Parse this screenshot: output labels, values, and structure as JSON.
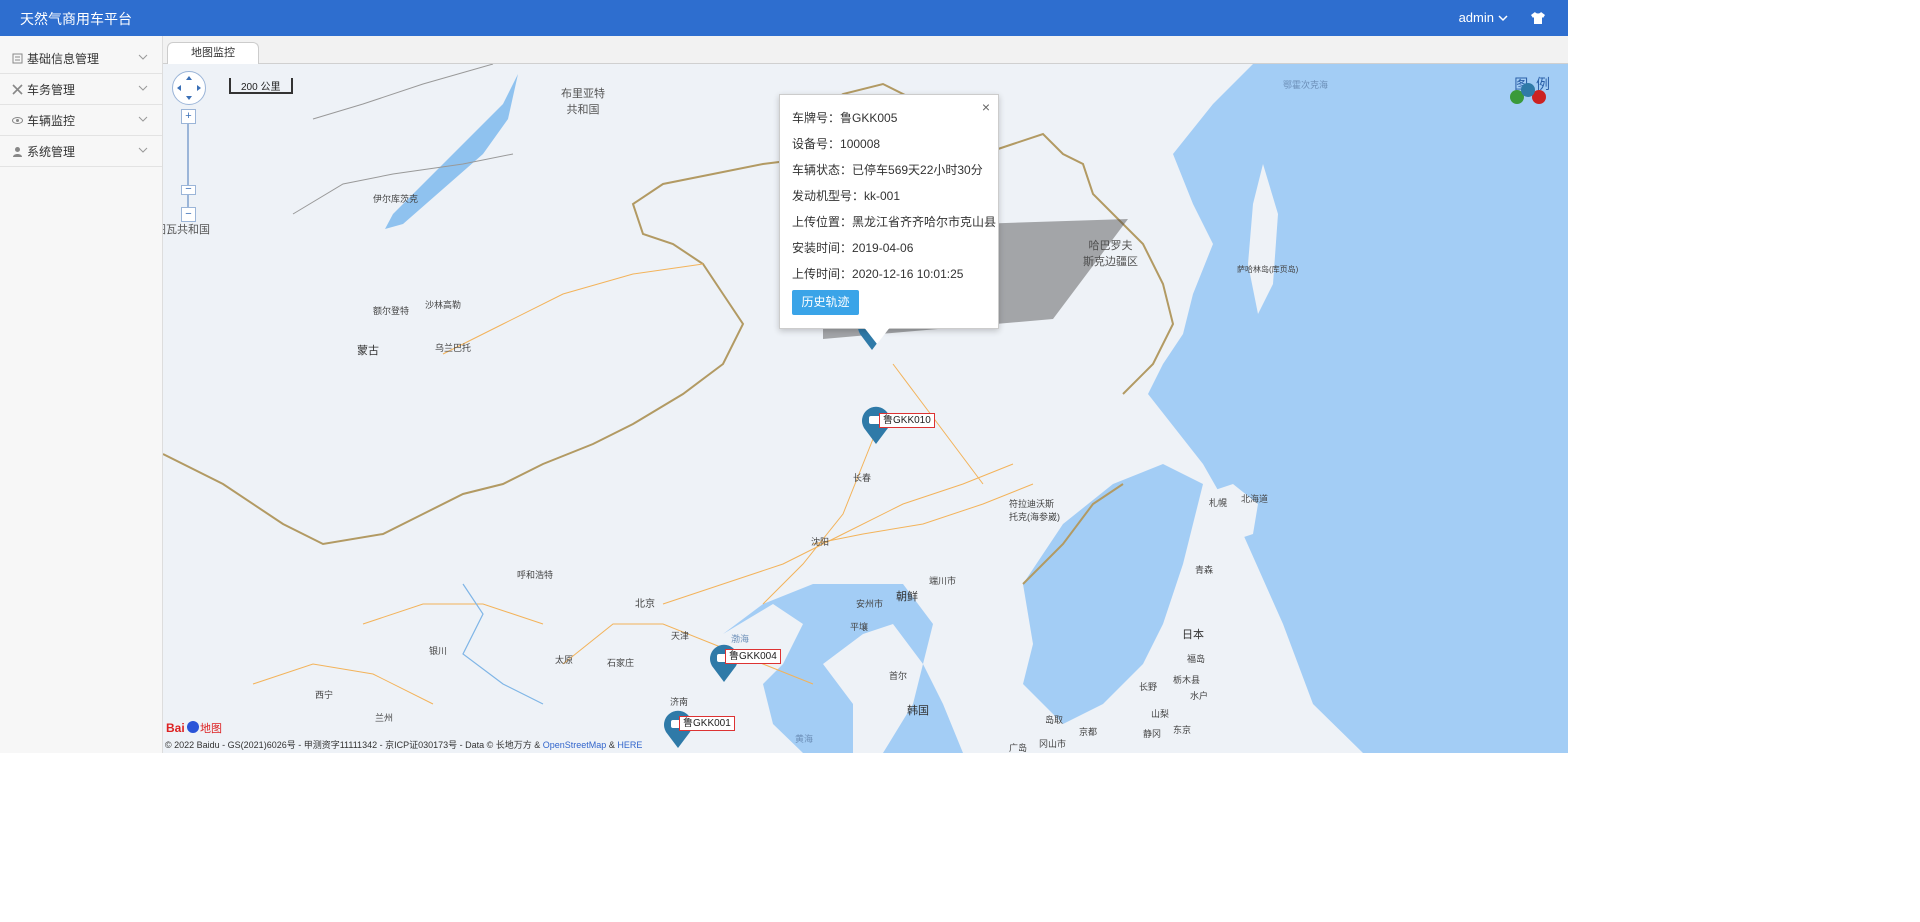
{
  "app": {
    "title": "天然气商用车平台"
  },
  "header": {
    "username": "admin",
    "theme_icon": "shirt-icon"
  },
  "sidebar": {
    "items": [
      {
        "label": "基础信息管理",
        "icon": "list-icon"
      },
      {
        "label": "车务管理",
        "icon": "tools-icon"
      },
      {
        "label": "车辆监控",
        "icon": "eye-icon"
      },
      {
        "label": "系统管理",
        "icon": "user-icon"
      }
    ]
  },
  "tabs": {
    "active": "地图监控"
  },
  "map": {
    "scale_label": "200 公里",
    "legend_label": "图  例",
    "places": [
      {
        "name": "鄂霍次克海",
        "kind": "sea"
      },
      {
        "name": "布里亚特\n共和国",
        "kind": "country"
      },
      {
        "name": "伊尔库茨克",
        "kind": "place"
      },
      {
        "name": "图瓦共和国",
        "kind": "country"
      },
      {
        "name": "额尔登特",
        "kind": "place"
      },
      {
        "name": "沙林高勒",
        "kind": "place"
      },
      {
        "name": "蒙古",
        "kind": "big"
      },
      {
        "name": "乌兰巴托",
        "kind": "place"
      },
      {
        "name": "哈巴罗夫\n斯克边疆区",
        "kind": "country"
      },
      {
        "name": "萨哈林岛(库页岛)",
        "kind": "place"
      },
      {
        "name": "长春",
        "kind": "place"
      },
      {
        "name": "符拉迪沃斯\n托克(海参崴)",
        "kind": "place"
      },
      {
        "name": "札幌",
        "kind": "place"
      },
      {
        "name": "北海道",
        "kind": "place"
      },
      {
        "name": "沈阳",
        "kind": "place"
      },
      {
        "name": "呼和浩特",
        "kind": "place"
      },
      {
        "name": "北京",
        "kind": "place"
      },
      {
        "name": "天津",
        "kind": "place"
      },
      {
        "name": "渤海",
        "kind": "sea"
      },
      {
        "name": "端川市",
        "kind": "place"
      },
      {
        "name": "安州市",
        "kind": "place"
      },
      {
        "name": "朝鲜",
        "kind": "big"
      },
      {
        "name": "平壤",
        "kind": "place"
      },
      {
        "name": "青森",
        "kind": "place"
      },
      {
        "name": "日本",
        "kind": "big"
      },
      {
        "name": "银川",
        "kind": "place"
      },
      {
        "name": "太原",
        "kind": "place"
      },
      {
        "name": "石家庄",
        "kind": "place"
      },
      {
        "name": "济南",
        "kind": "place"
      },
      {
        "name": "首尔",
        "kind": "place"
      },
      {
        "name": "韩国",
        "kind": "big"
      },
      {
        "name": "福岛",
        "kind": "place"
      },
      {
        "name": "栃木县",
        "kind": "place"
      },
      {
        "name": "长野",
        "kind": "place"
      },
      {
        "name": "水户",
        "kind": "place"
      },
      {
        "name": "山梨",
        "kind": "place"
      },
      {
        "name": "东京",
        "kind": "place"
      },
      {
        "name": "静冈",
        "kind": "place"
      },
      {
        "name": "西宁",
        "kind": "place"
      },
      {
        "name": "兰州",
        "kind": "place"
      },
      {
        "name": "黄海",
        "kind": "sea"
      },
      {
        "name": "岛取",
        "kind": "place"
      },
      {
        "name": "京都",
        "kind": "place"
      },
      {
        "name": "冈山市",
        "kind": "place"
      },
      {
        "name": "广岛",
        "kind": "place"
      }
    ],
    "vehicles": [
      {
        "plate": "鲁GKK010"
      },
      {
        "plate": "鲁GKK004"
      },
      {
        "plate": "鲁GKK001"
      }
    ],
    "popup": {
      "plate_label": "车牌号：",
      "plate": "鲁GKK005",
      "device_label": "设备号：",
      "device": "100008",
      "status_label": "车辆状态：",
      "status": "已停车569天22小时30分",
      "engine_label": "发动机型号：",
      "engine": "kk-001",
      "location_label": "上传位置：",
      "location": "黑龙江省齐齐哈尔市克山县",
      "install_label": "安装时间：",
      "install": "2019-04-06",
      "upload_label": "上传时间：",
      "upload": "2020-12-16 10:01:25",
      "history_button": "历史轨迹",
      "close": "×"
    },
    "copyright": {
      "text": "© 2022 Baidu - GS(2021)6026号 - 甲测资字11111342 - 京ICP证030173号 - Data © 长地万方 &",
      "osm": "OpenStreetMap",
      "amp": "&",
      "here": "HERE"
    },
    "logo_text": "Bai地图"
  },
  "colors": {
    "header": "#2e6ecf",
    "sea": "#a3cdf5",
    "land": "#eef2f7",
    "marker": "#2f7aa8",
    "popup_button": "#3aa4e8"
  }
}
